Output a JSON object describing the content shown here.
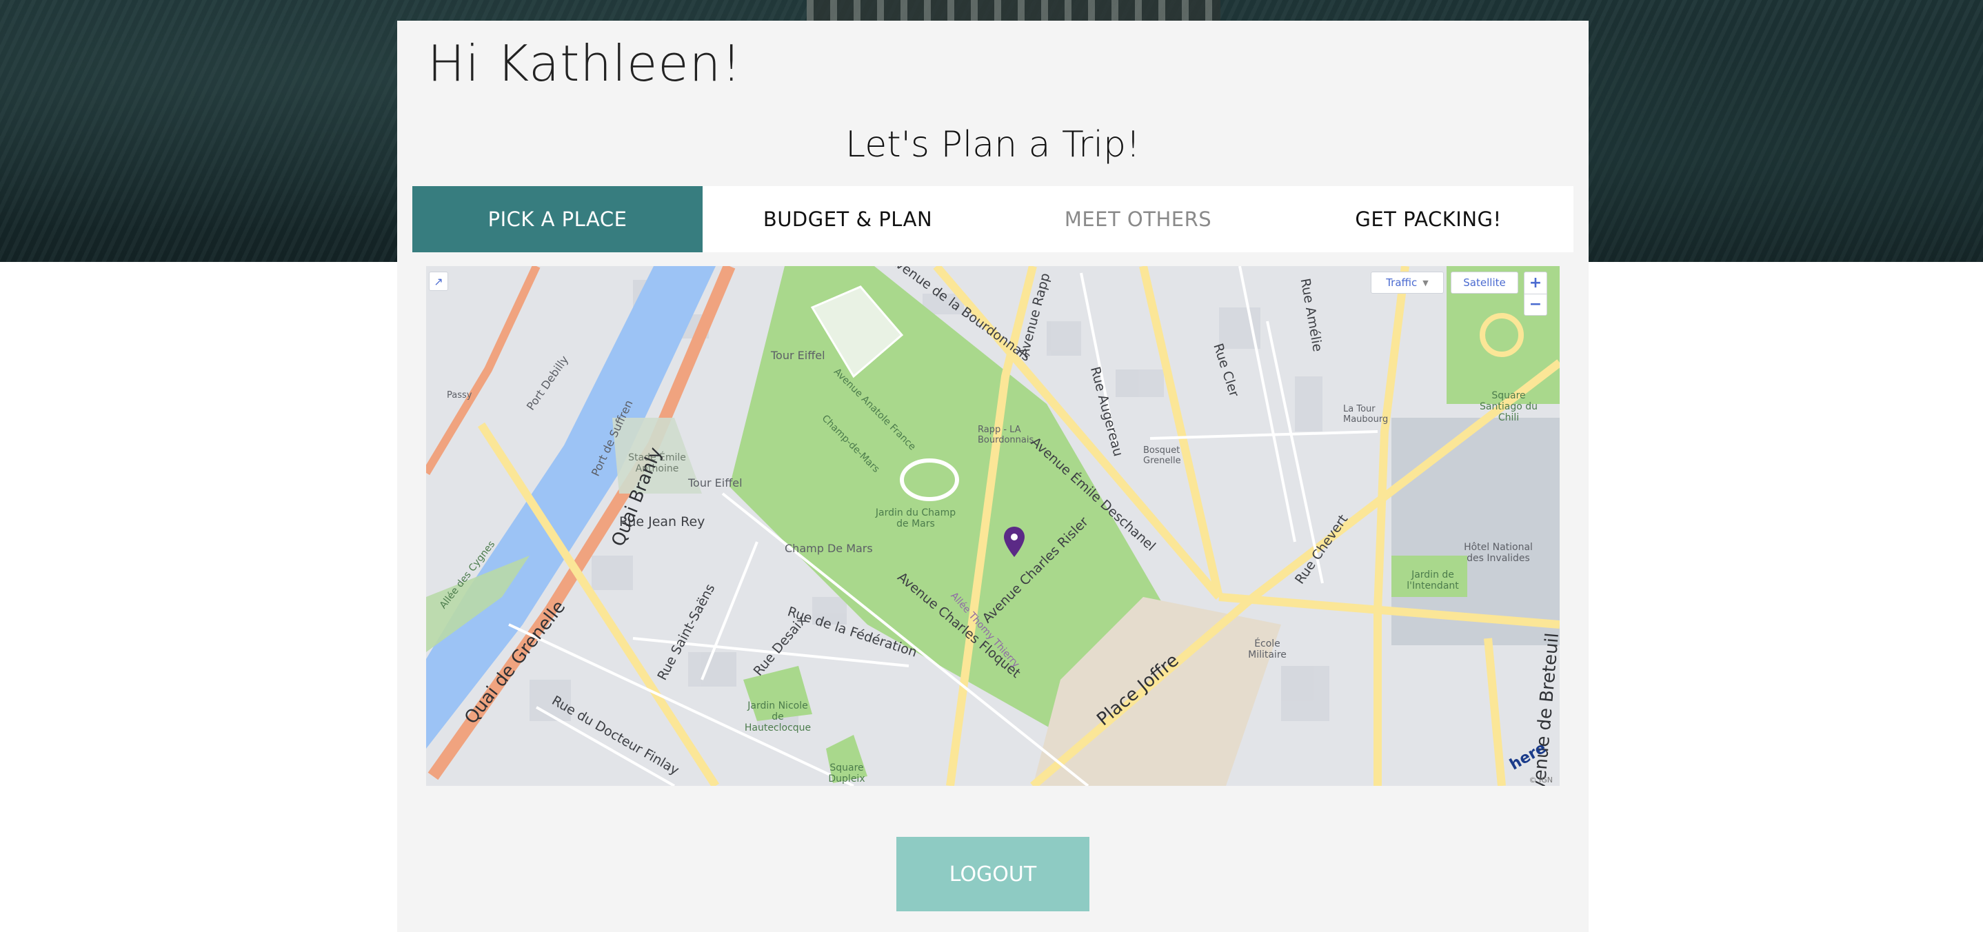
{
  "greeting": "Hi Kathleen!",
  "subtitle": "Let's Plan a Trip!",
  "tabs": [
    {
      "label": "PICK A PLACE"
    },
    {
      "label": "BUDGET & PLAN"
    },
    {
      "label": "MEET OTHERS"
    },
    {
      "label": "GET PACKING!"
    }
  ],
  "map": {
    "traffic_label": "Traffic",
    "satellite_label": "Satellite",
    "zoom_in": "+",
    "zoom_out": "−",
    "labels": {
      "tour_eiffel": "Tour Eiffel",
      "tour_eiffel_stop": "Tour Eiffel",
      "champ_de_mars_park": "Avenue Anatole France",
      "champ_de_mars": "Champ-de-Mars",
      "jardin": "Jardin du Champ de Mars",
      "stade": "Stade Émile Anthoine",
      "quai_branly": "Quai Branly",
      "quai_grenelle": "Quai de Grenelle",
      "rue_jean_rey": "Rue Jean Rey",
      "av_bourdonnais": "Avenue de la Bourdonnais",
      "av_rapp": "Avenue Rapp",
      "av_deschanel": "Avenue Émile Deschanel",
      "av_floquet": "Avenue Charles Floquet",
      "av_risler": "Avenue Charles Risler",
      "allee_thierry": "Allée Thomy Thierry",
      "place_joffre": "Place Joffre",
      "rue_federation": "Rue de la Fédération",
      "rue_desaix": "Rue Desaix",
      "rue_cler": "Rue Cler",
      "rue_chevert": "Rue Chevert",
      "av_breteuil": "Avenue de Breteuil",
      "hotel_invalides": "Hôtel National des Invalides",
      "ecole_militaire": "École Militaire",
      "square_santiago": "Square Santiago du Chili",
      "jardin_intendant": "Jardin de l'Intendant",
      "rue_docteur_finlay": "Rue du Docteur Finlay",
      "champ_de_mars_stop": "Champ De Mars",
      "rue_saint_saens": "Rue Saint-Saëns",
      "port_debilly": "Port Debilly",
      "port_suffren": "Port de Suffren",
      "allee_cygnes": "Allée des Cygnes",
      "jardin_nicole": "Jardin Nicole de Hauteclocque",
      "square_duplex": "Square Dupleix",
      "rapp_stop": "Rapp - LA Bourdonnais",
      "bosquet": "Bosquet Grenelle",
      "la_tour_maubourg": "La Tour Maubourg",
      "passy": "Passy",
      "rue_augereau": "Rue Augereau",
      "rue_amelie": "Rue Amélie"
    },
    "brand": "here",
    "copyright": "© IGN"
  },
  "logout_label": "LOGOUT"
}
